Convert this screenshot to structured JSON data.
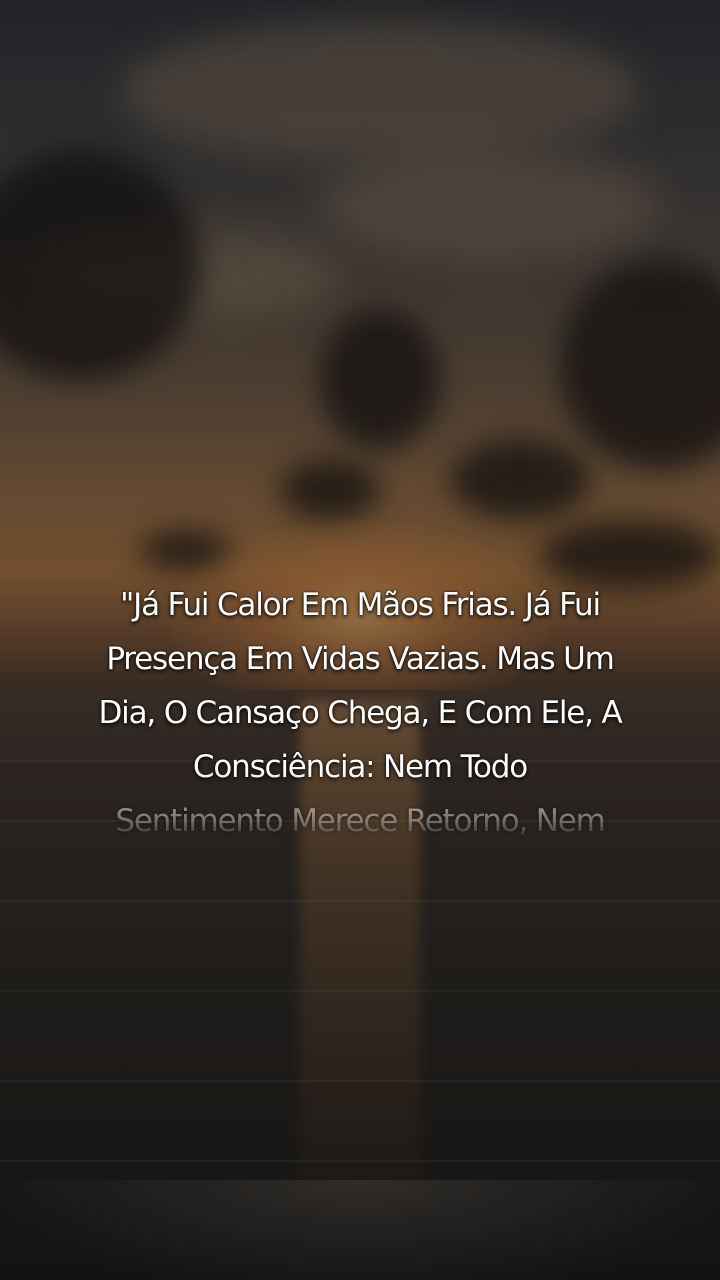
{
  "quote": {
    "lines": [
      "\"Já Fui Calor Em Mãos Frias. Já Fui",
      "Presença Em Vidas Vazias. Mas Um",
      "Dia, O Cansaço Chega, E Com Ele, A",
      "Consciência: Nem Todo",
      "Sentimento Merece Retorno, Nem"
    ]
  },
  "background": {
    "scene": "sunset-over-sea",
    "colors": {
      "sky_top": "#2a2d33",
      "horizon": "#9a6a3c",
      "sea": "#262320",
      "text": "#ffffff"
    }
  }
}
